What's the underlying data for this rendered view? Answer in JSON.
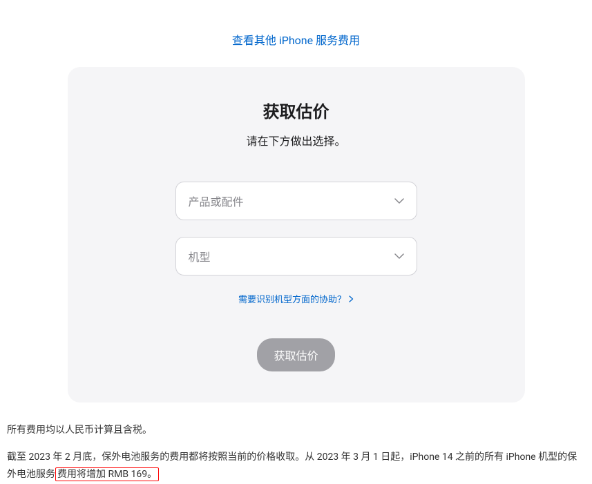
{
  "topLink": {
    "text": "查看其他 iPhone 服务费用"
  },
  "card": {
    "title": "获取估价",
    "subtitle": "请在下方做出选择。",
    "selectProduct": {
      "placeholder": "产品或配件"
    },
    "selectModel": {
      "placeholder": "机型"
    },
    "helpLink": {
      "text": "需要识别机型方面的协助？"
    },
    "submitButton": {
      "label": "获取估价"
    }
  },
  "footer": {
    "line1": "所有费用均以人民币计算且含税。",
    "line2Start": "截至 2023 年 2 月底，保外电池服务的费用都将按照当前的价格收取。从 2023 年 3 月 1 日起，iPhone 14 之前的所有 iPhone 机型的保外电池服务",
    "line2Highlight": "费用将增加 RMB 169。"
  }
}
